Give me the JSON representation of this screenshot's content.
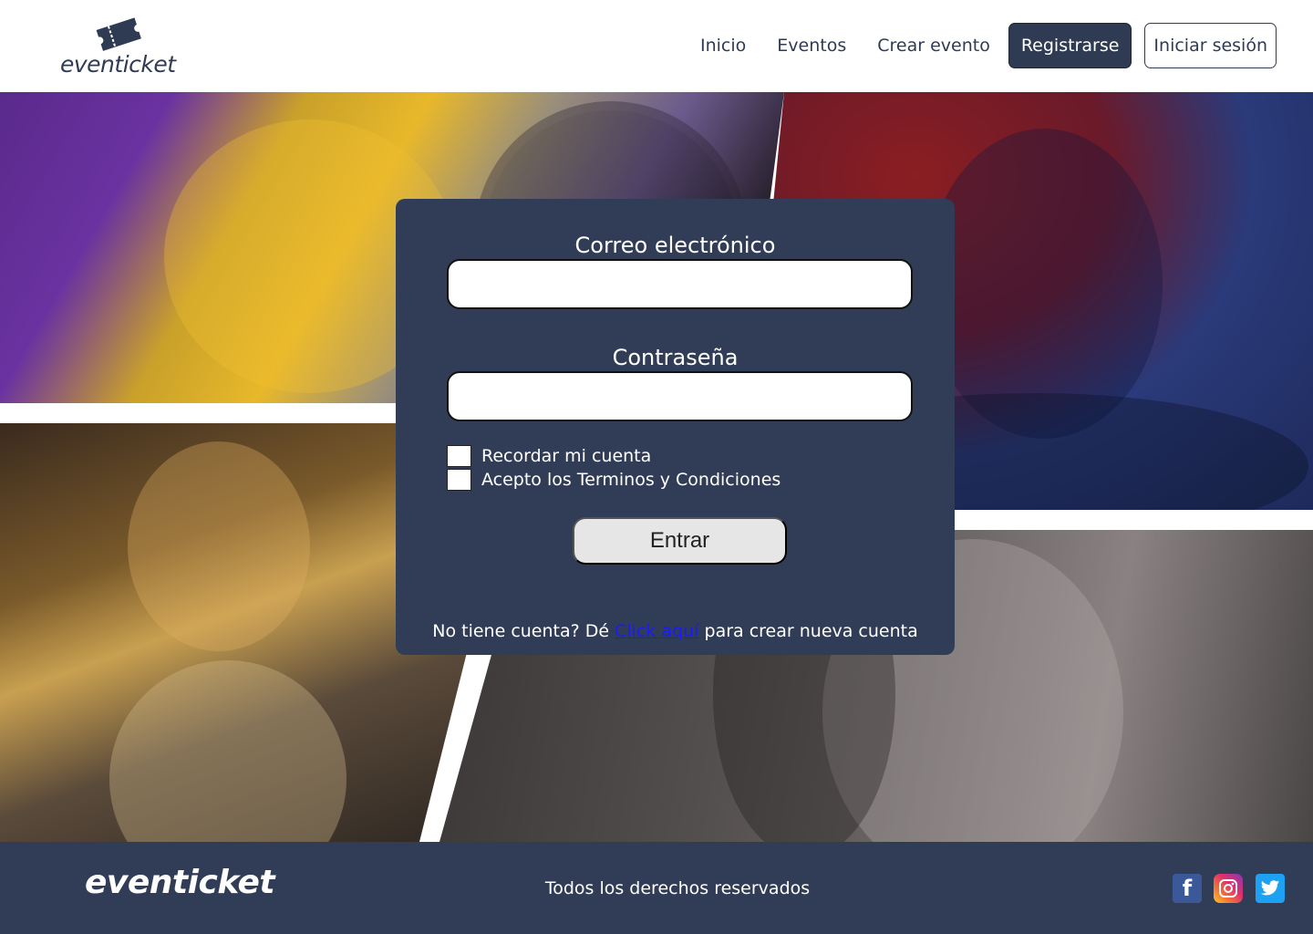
{
  "header": {
    "logo_text": "eventicket",
    "nav": {
      "inicio": "Inicio",
      "eventos": "Eventos",
      "crear_evento": "Crear evento",
      "registrarse": "Registrarse",
      "iniciar_sesion": "Iniciar sesión"
    }
  },
  "form": {
    "email_label": "Correo electrónico",
    "email_value": "",
    "password_label": "Contraseña",
    "password_value": "",
    "remember_label": "Recordar mi cuenta",
    "terms_label": "Acepto los Terminos y Condiciones",
    "submit_label": "Entrar",
    "signup_prefix": "No tiene cuenta? Dé ",
    "signup_link": "Click aquí",
    "signup_suffix": " para crear nueva cuenta"
  },
  "footer": {
    "logo_text": "eventicket",
    "copyright": "Todos los derechos reservados",
    "social_icons": [
      "facebook-icon",
      "instagram-icon",
      "twitter-icon"
    ]
  },
  "colors": {
    "brand_dark": "#313c57",
    "link": "#1a1aff"
  }
}
